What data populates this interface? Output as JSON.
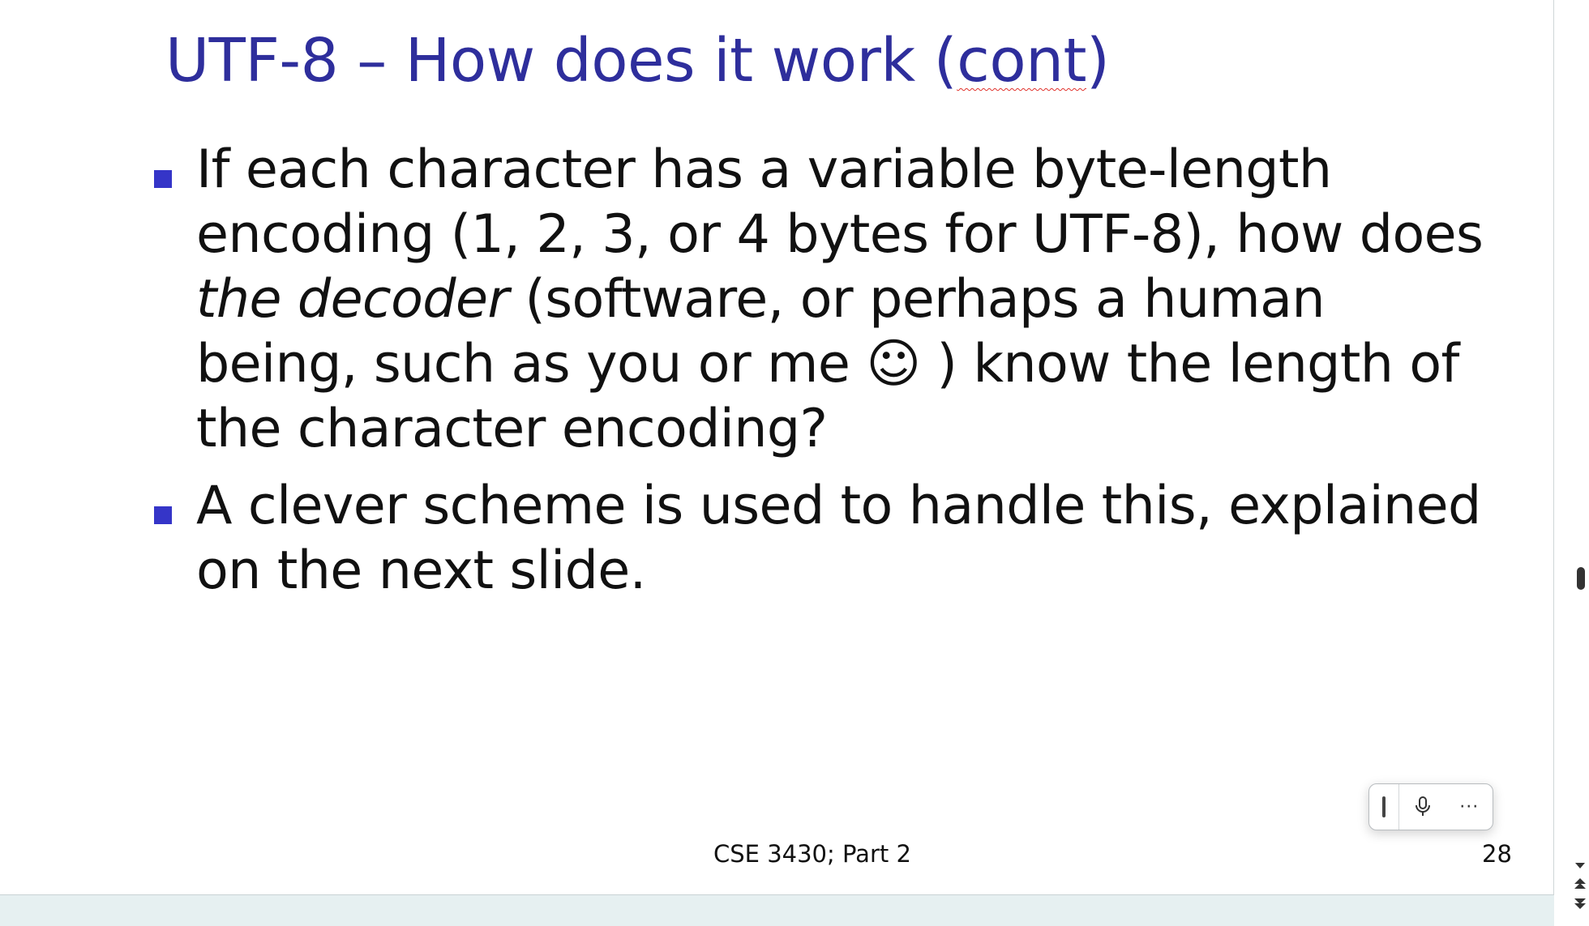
{
  "slide": {
    "title_main": "UTF-8 – How does it work (",
    "title_squiggle": "cont",
    "title_end": ")",
    "bullets": [
      {
        "text_before": "If each character has a variable byte-length encoding (1, 2, 3, or 4 bytes for UTF-8), how does ",
        "text_italic": "the decoder",
        "text_after": " (software, or perhaps a human being, such as you or me ☺ ) know the length of the character encoding?"
      },
      {
        "text": "A clever scheme is used to handle this, explained on the next slide."
      }
    ],
    "footer": "CSE 3430; Part 2",
    "page_number": "28"
  },
  "toolbar": {
    "icons": [
      "grip-icon",
      "microphone-icon",
      "more-icon"
    ],
    "more_label": "···"
  },
  "colors": {
    "title": "#2e2e9c",
    "bullet_marker": "#3535c8",
    "spell_squiggle": "#e0302a",
    "background": "#e6f0f1"
  }
}
